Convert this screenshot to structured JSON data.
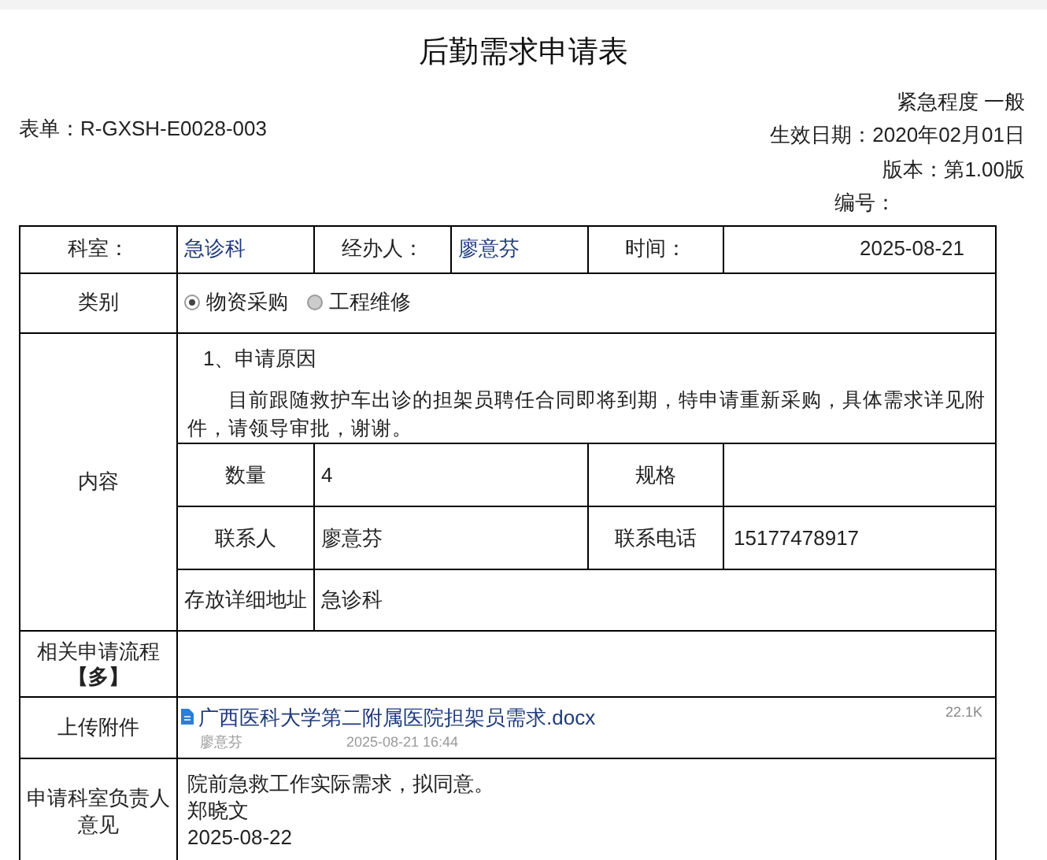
{
  "title": "后勤需求申请表",
  "header": {
    "form_no": "表单：R-GXSH-E0028-003",
    "urgency": "紧急程度 一般",
    "effective_date": "生效日期：2020年02月01日",
    "version": "版本：第1.00版",
    "number_label": "编号："
  },
  "info_row": {
    "dept_label": "科室：",
    "dept": "急诊科",
    "handler_label": "经办人：",
    "handler": "廖意芬",
    "time_label": "时间：",
    "time": "2025-08-21"
  },
  "category": {
    "label": "类别",
    "options": [
      {
        "label": "物资采购",
        "selected": true
      },
      {
        "label": "工程维修",
        "selected": false
      }
    ]
  },
  "content": {
    "label": "内容",
    "heading": "1、申请原因",
    "body": "目前跟随救护车出诊的担架员聘任合同即将到期，特申请重新采购，具体需求详见附件，请领导审批，谢谢。",
    "fields": [
      {
        "label": "数量",
        "value": "4",
        "label2": "规格"
      },
      {
        "label": "联系人",
        "value": "廖意芬",
        "label2": "联系电话",
        "value2": "15177478917"
      }
    ],
    "address_label": "存放详细地址",
    "address": "急诊科"
  },
  "related": {
    "label": "相关申请流程",
    "link": "【多】"
  },
  "attachment": {
    "label": "上传附件",
    "file": "广西医科大学第二附属医院担架员需求.docx",
    "size": "22.1K",
    "uploader": "廖意芬",
    "uploaded": "2025-08-21 16:44"
  },
  "opinion": {
    "label_1": "申请科室负责人",
    "label_2": "意见",
    "text": "院前急救工作实际需求，拟同意。",
    "signer": "郑晓文",
    "date": "2025-08-22"
  }
}
